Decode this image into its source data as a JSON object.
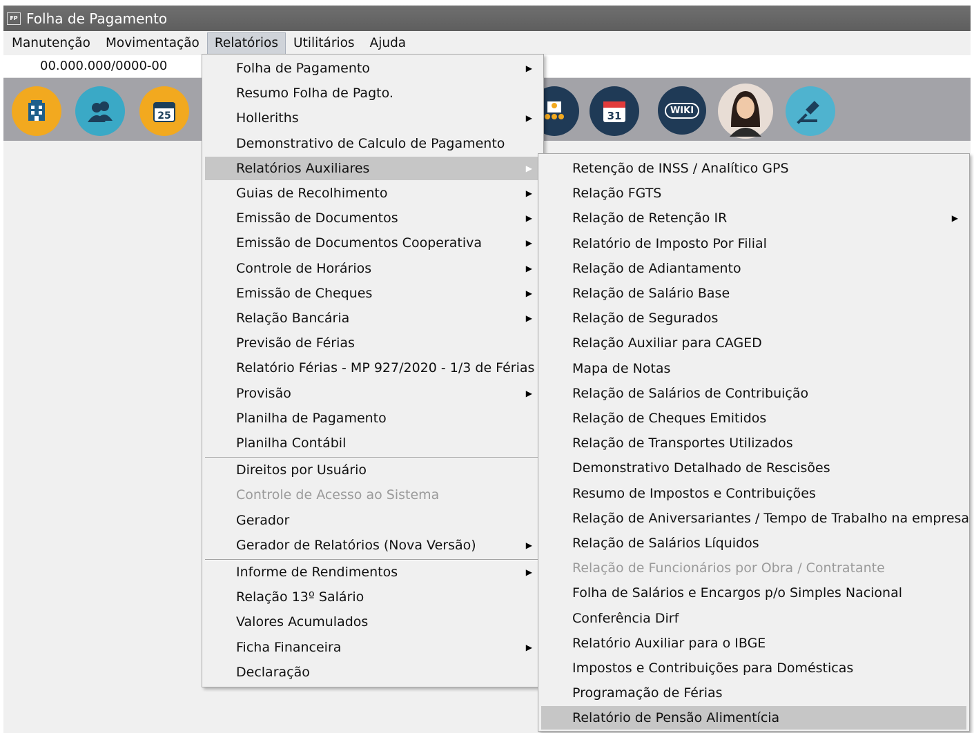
{
  "window": {
    "title": "Folha de Pagamento",
    "app_icon": "FP"
  },
  "menubar": [
    "Manutenção",
    "Movimentação",
    "Relatórios",
    "Utilitários",
    "Ajuda"
  ],
  "cnpj": "00.000.000/0000-00",
  "toolbar": {
    "icons": [
      "building-icon",
      "users-icon",
      "calendar-25-icon",
      "team-icon",
      "calendar-31-icon",
      "wiki-icon",
      "avatar-assistant-icon",
      "gavel-icon"
    ],
    "calendar_day_1": "25",
    "calendar_day_2": "31",
    "wiki_label": "WIKI"
  },
  "reports_menu": [
    {
      "label": "Folha de Pagamento",
      "submenu": true
    },
    {
      "label": "Resumo Folha de Pagto.",
      "submenu": false
    },
    {
      "label": "Holleriths",
      "submenu": true
    },
    {
      "label": "Demonstrativo de Calculo de Pagamento",
      "submenu": false
    },
    {
      "label": "Relatórios Auxiliares",
      "submenu": true,
      "highlighted": true
    },
    {
      "label": "Guias de Recolhimento",
      "submenu": true
    },
    {
      "label": "Emissão de Documentos",
      "submenu": true
    },
    {
      "label": "Emissão de Documentos Cooperativa",
      "submenu": true
    },
    {
      "label": "Controle de Horários",
      "submenu": true
    },
    {
      "label": "Emissão de Cheques",
      "submenu": true
    },
    {
      "label": "Relação Bancária",
      "submenu": true
    },
    {
      "label": "Previsão de Férias",
      "submenu": false
    },
    {
      "label": "Relatório Férias - MP 927/2020 - 1/3 de Férias",
      "submenu": false
    },
    {
      "label": "Provisão",
      "submenu": true
    },
    {
      "label": "Planilha de Pagamento",
      "submenu": false
    },
    {
      "label": "Planilha Contábil",
      "submenu": false
    },
    {
      "label": "Direitos por Usuário",
      "submenu": false,
      "separator_before": true
    },
    {
      "label": "Controle de Acesso ao Sistema",
      "submenu": false,
      "disabled": true
    },
    {
      "label": "Gerador",
      "submenu": false
    },
    {
      "label": "Gerador de Relatórios (Nova Versão)",
      "submenu": true
    },
    {
      "label": "Informe de Rendimentos",
      "submenu": true,
      "separator_before": true
    },
    {
      "label": "Relação 13º Salário",
      "submenu": false
    },
    {
      "label": "Valores Acumulados",
      "submenu": false
    },
    {
      "label": "Ficha Financeira",
      "submenu": true
    },
    {
      "label": "Declaração",
      "submenu": false
    }
  ],
  "aux_menu": [
    {
      "label": "Retenção de INSS / Analítico GPS",
      "submenu": false
    },
    {
      "label": "Relação FGTS",
      "submenu": false
    },
    {
      "label": "Relação de Retenção IR",
      "submenu": true
    },
    {
      "label": "Relatório de Imposto Por Filial",
      "submenu": false
    },
    {
      "label": "Relação de Adiantamento",
      "submenu": false
    },
    {
      "label": "Relação de Salário Base",
      "submenu": false
    },
    {
      "label": "Relação de Segurados",
      "submenu": false
    },
    {
      "label": "Relação Auxiliar para CAGED",
      "submenu": false
    },
    {
      "label": "Mapa de Notas",
      "submenu": false
    },
    {
      "label": "Relação de Salários de Contribuição",
      "submenu": false
    },
    {
      "label": "Relação de Cheques Emitidos",
      "submenu": false
    },
    {
      "label": "Relação de Transportes Utilizados",
      "submenu": false
    },
    {
      "label": "Demonstrativo Detalhado de Rescisões",
      "submenu": false
    },
    {
      "label": "Resumo de Impostos e Contribuições",
      "submenu": false
    },
    {
      "label": "Relação de Aniversariantes / Tempo de Trabalho na empresa",
      "submenu": false
    },
    {
      "label": "Relação de Salários Líquidos",
      "submenu": false
    },
    {
      "label": "Relação de Funcionários por Obra / Contratante",
      "submenu": false,
      "disabled": true
    },
    {
      "label": "Folha de Salários e Encargos p/o Simples Nacional",
      "submenu": false
    },
    {
      "label": "Conferência Dirf",
      "submenu": false
    },
    {
      "label": "Relatório Auxiliar para o IBGE",
      "submenu": false
    },
    {
      "label": "Impostos e Contribuições para Domésticas",
      "submenu": false
    },
    {
      "label": "Programação de Férias",
      "submenu": false
    },
    {
      "label": "Relatório de Pensão Alimentícia",
      "submenu": false,
      "highlighted": true
    }
  ],
  "arrow_glyph": "▶"
}
